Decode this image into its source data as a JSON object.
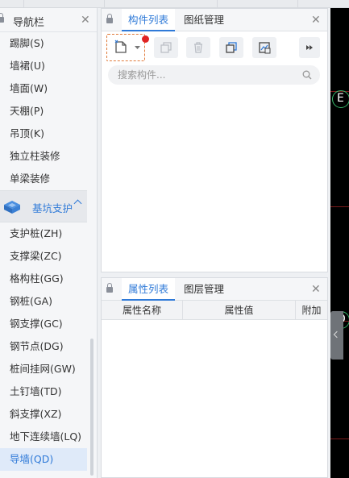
{
  "navigator": {
    "title": "导航栏",
    "items_top": [
      "踢脚(S)",
      "墙裙(U)",
      "墙面(W)",
      "天棚(P)",
      "吊顶(K)",
      "独立柱装修",
      "单梁装修"
    ],
    "group": {
      "label": "基坑支护",
      "expanded": true
    },
    "items_bottom": [
      "支护桩(ZH)",
      "支撑梁(ZC)",
      "格构柱(GG)",
      "钢桩(GA)",
      "钢支撑(GC)",
      "钢节点(DG)",
      "桩间挂网(GW)",
      "土钉墙(TD)",
      "斜支撑(XZ)",
      "地下连续墙(LQ)",
      "导墙(QD)"
    ],
    "active_item": "导墙(QD)"
  },
  "component_panel": {
    "tabs": [
      "构件列表",
      "图纸管理"
    ],
    "active_tab": "构件列表",
    "search_placeholder": "搜索构件..."
  },
  "property_panel": {
    "tabs": [
      "属性列表",
      "图层管理"
    ],
    "active_tab": "属性列表",
    "columns": [
      "属性名称",
      "属性值",
      "附加"
    ]
  },
  "canvas": {
    "markers": [
      "E",
      "D"
    ]
  },
  "colors": {
    "accent": "#2f7ad8",
    "highlight_dash": "#e07a3a",
    "notify_dot": "#e02323"
  }
}
